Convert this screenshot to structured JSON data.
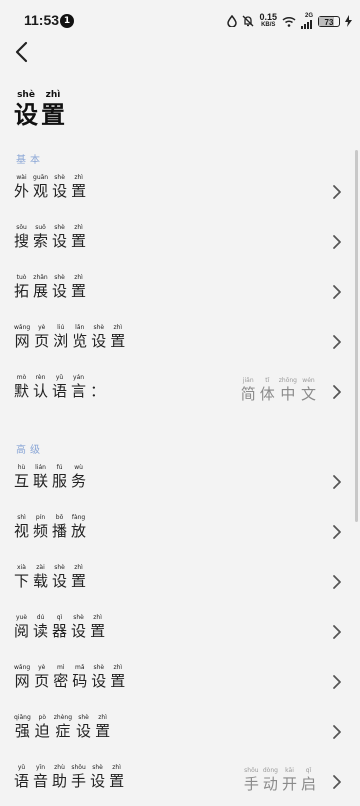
{
  "status_bar": {
    "time": "11:53",
    "notification_count": "1",
    "net_speed": "0.15",
    "net_unit": "KB/S",
    "signal_label": "2G",
    "battery": "73",
    "battery_level_percent": 73,
    "icons": [
      "water-drop-icon",
      "mute-bell-icon",
      "wifi-icon",
      "cell-signal-icon",
      "battery-icon",
      "charging-bolt-icon"
    ]
  },
  "header": {
    "back_icon": "back-arrow-icon"
  },
  "page_title": [
    {
      "hz": "设",
      "py": "shè"
    },
    {
      "hz": "置",
      "py": "zhì"
    }
  ],
  "sections": [
    {
      "title": [
        {
          "hz": "基",
          "py": ""
        },
        {
          "hz": "本",
          "py": ""
        }
      ],
      "items": [
        {
          "label": [
            {
              "hz": "外",
              "py": "wài"
            },
            {
              "hz": "观",
              "py": "guān"
            },
            {
              "hz": "设",
              "py": "shè"
            },
            {
              "hz": "置",
              "py": "zhì"
            }
          ]
        },
        {
          "label": [
            {
              "hz": "搜",
              "py": "sōu"
            },
            {
              "hz": "索",
              "py": "suǒ"
            },
            {
              "hz": "设",
              "py": "shè"
            },
            {
              "hz": "置",
              "py": "zhì"
            }
          ]
        },
        {
          "label": [
            {
              "hz": "拓",
              "py": "tuò"
            },
            {
              "hz": "展",
              "py": "zhǎn"
            },
            {
              "hz": "设",
              "py": "shè"
            },
            {
              "hz": "置",
              "py": "zhì"
            }
          ]
        },
        {
          "label": [
            {
              "hz": "网",
              "py": "wǎng"
            },
            {
              "hz": "页",
              "py": "yè"
            },
            {
              "hz": "浏",
              "py": "liú"
            },
            {
              "hz": "览",
              "py": "lǎn"
            },
            {
              "hz": "设",
              "py": "shè"
            },
            {
              "hz": "置",
              "py": "zhì"
            }
          ]
        },
        {
          "label": [
            {
              "hz": "默",
              "py": "mò"
            },
            {
              "hz": "认",
              "py": "rèn"
            },
            {
              "hz": "语",
              "py": "yǔ"
            },
            {
              "hz": "言",
              "py": "yán"
            },
            {
              "hz": "：",
              "py": ""
            }
          ],
          "value": [
            {
              "hz": "简",
              "py": "jiǎn"
            },
            {
              "hz": "体",
              "py": "tǐ"
            },
            {
              "hz": "中",
              "py": "zhōng"
            },
            {
              "hz": "文",
              "py": "wén"
            }
          ]
        }
      ]
    },
    {
      "title": [
        {
          "hz": "高",
          "py": ""
        },
        {
          "hz": "级",
          "py": ""
        }
      ],
      "items": [
        {
          "label": [
            {
              "hz": "互",
              "py": "hù"
            },
            {
              "hz": "联",
              "py": "lián"
            },
            {
              "hz": "服",
              "py": "fú"
            },
            {
              "hz": "务",
              "py": "wù"
            }
          ]
        },
        {
          "label": [
            {
              "hz": "视",
              "py": "shì"
            },
            {
              "hz": "频",
              "py": "pín"
            },
            {
              "hz": "播",
              "py": "bō"
            },
            {
              "hz": "放",
              "py": "fàng"
            }
          ]
        },
        {
          "label": [
            {
              "hz": "下",
              "py": "xià"
            },
            {
              "hz": "载",
              "py": "zài"
            },
            {
              "hz": "设",
              "py": "shè"
            },
            {
              "hz": "置",
              "py": "zhì"
            }
          ]
        },
        {
          "label": [
            {
              "hz": "阅",
              "py": "yuè"
            },
            {
              "hz": "读",
              "py": "dú"
            },
            {
              "hz": "器",
              "py": "qì"
            },
            {
              "hz": "设",
              "py": "shè"
            },
            {
              "hz": "置",
              "py": "zhì"
            }
          ]
        },
        {
          "label": [
            {
              "hz": "网",
              "py": "wǎng"
            },
            {
              "hz": "页",
              "py": "yè"
            },
            {
              "hz": "密",
              "py": "mì"
            },
            {
              "hz": "码",
              "py": "mǎ"
            },
            {
              "hz": "设",
              "py": "shè"
            },
            {
              "hz": "置",
              "py": "zhì"
            }
          ]
        },
        {
          "label": [
            {
              "hz": "强",
              "py": "qiǎng"
            },
            {
              "hz": "迫",
              "py": "pò"
            },
            {
              "hz": "症",
              "py": "zhèng"
            },
            {
              "hz": "设",
              "py": "shè"
            },
            {
              "hz": "置",
              "py": "zhì"
            }
          ]
        },
        {
          "label": [
            {
              "hz": "语",
              "py": "yǔ"
            },
            {
              "hz": "音",
              "py": "yīn"
            },
            {
              "hz": "助",
              "py": "zhù"
            },
            {
              "hz": "手",
              "py": "shǒu"
            },
            {
              "hz": "设",
              "py": "shè"
            },
            {
              "hz": "置",
              "py": "zhì"
            }
          ],
          "value": [
            {
              "hz": "手",
              "py": "shǒu"
            },
            {
              "hz": "动",
              "py": "dòng"
            },
            {
              "hz": "开",
              "py": "kāi"
            },
            {
              "hz": "启",
              "py": "qǐ"
            }
          ]
        }
      ]
    }
  ],
  "colors": {
    "background": "#f3f3f3",
    "section_header": "#8aa6d6",
    "value_text": "#8a8a8a",
    "chevron": "#555555"
  }
}
